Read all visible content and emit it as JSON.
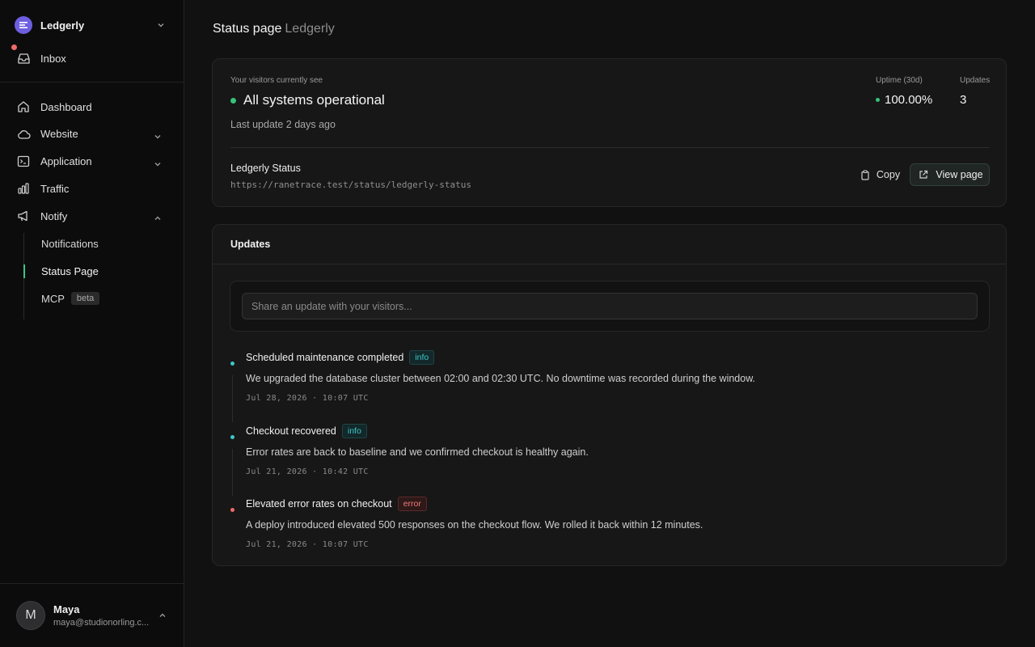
{
  "sidebar": {
    "workspace": "Ledgerly",
    "inbox": "Inbox",
    "nav": [
      {
        "label": "Dashboard",
        "icon": "home-icon",
        "chevron": ""
      },
      {
        "label": "Website",
        "icon": "cloud-icon",
        "chevron": "down"
      },
      {
        "label": "Application",
        "icon": "terminal-icon",
        "chevron": "down"
      },
      {
        "label": "Traffic",
        "icon": "bar-chart-icon",
        "chevron": ""
      },
      {
        "label": "Notify",
        "icon": "megaphone-icon",
        "chevron": "up"
      }
    ],
    "notify_sub": [
      {
        "label": "Notifications"
      },
      {
        "label": "Status Page",
        "active": true
      },
      {
        "label": "MCP",
        "badge": "beta"
      }
    ],
    "user": {
      "initial": "M",
      "name": "Maya",
      "email": "maya@studionorling.c..."
    }
  },
  "page": {
    "title": "Status page",
    "subtitle": "Ledgerly"
  },
  "overview": {
    "visitors_label": "Your visitors currently see",
    "status": "All systems operational",
    "last_update": "Last update 2 days ago",
    "uptime_label": "Uptime (30d)",
    "uptime_value": "100.00%",
    "updates_label": "Updates",
    "updates_value": "3",
    "site_name": "Ledgerly Status",
    "site_url": "https://ranetrace.test/status/ledgerly-status",
    "copy_label": "Copy",
    "view_label": "View page"
  },
  "updates": {
    "title": "Updates",
    "composer_placeholder": "Share an update with your visitors...",
    "items": [
      {
        "title": "Scheduled maintenance completed",
        "tag": "info",
        "body": "We upgraded the database cluster between 02:00 and 02:30 UTC. No downtime was recorded during the window.",
        "timestamp": "Jul 28, 2026 · 10:07 UTC"
      },
      {
        "title": "Checkout recovered",
        "tag": "info",
        "body": "Error rates are back to baseline and we confirmed checkout is healthy again.",
        "timestamp": "Jul 21, 2026 · 10:42 UTC"
      },
      {
        "title": "Elevated error rates on checkout",
        "tag": "error",
        "body": "A deploy introduced elevated 500 responses on the checkout flow. We rolled it back within 12 minutes.",
        "timestamp": "Jul 21, 2026 · 10:07 UTC"
      }
    ]
  },
  "colors": {
    "accent_green": "#34c37a",
    "info": "#3cc8c8",
    "error": "#f07a7a",
    "workspace": "#6d5fe0"
  }
}
